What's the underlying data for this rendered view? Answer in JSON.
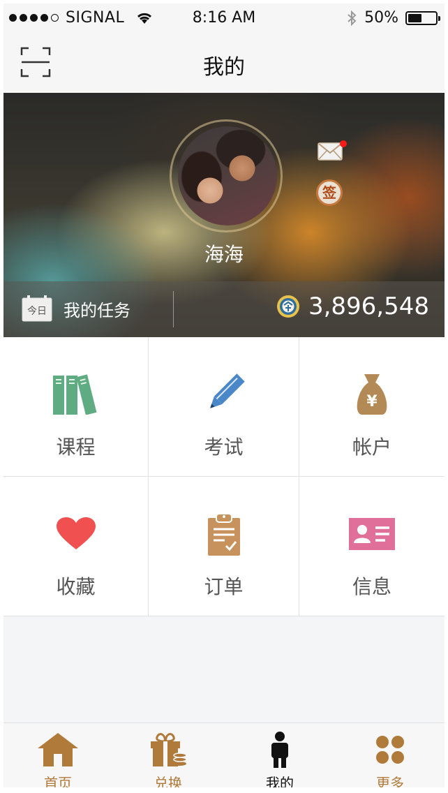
{
  "status_bar": {
    "carrier": "SIGNAL",
    "time": "8:16 AM",
    "battery": "50%",
    "battery_level": 0.5
  },
  "nav": {
    "title": "我的"
  },
  "profile": {
    "name": "海海",
    "sign_label": "签",
    "has_unread_mail": true
  },
  "task_bar": {
    "calendar_label": "今日",
    "tasks_label": "我的任务",
    "coin_balance": "3,896,548"
  },
  "grid": {
    "items": [
      {
        "label": "课程",
        "icon": "books-icon",
        "color": "#5fac82"
      },
      {
        "label": "考试",
        "icon": "pencil-icon",
        "color": "#4a87c8"
      },
      {
        "label": "帐户",
        "icon": "money-bag-icon",
        "color": "#b38a55"
      },
      {
        "label": "收藏",
        "icon": "heart-icon",
        "color": "#f05050"
      },
      {
        "label": "订单",
        "icon": "clipboard-icon",
        "color": "#c7925b"
      },
      {
        "label": "信息",
        "icon": "id-card-icon",
        "color": "#e06f9a"
      }
    ]
  },
  "tabs": [
    {
      "label": "首页",
      "icon": "home-icon",
      "active": false
    },
    {
      "label": "兑换",
      "icon": "gift-icon",
      "active": false
    },
    {
      "label": "我的",
      "icon": "person-icon",
      "active": true
    },
    {
      "label": "更多",
      "icon": "more-dots-icon",
      "active": false
    }
  ],
  "colors": {
    "accent": "#b07a3a",
    "active_tab": "#111111",
    "notification": "#ff1a1a"
  }
}
